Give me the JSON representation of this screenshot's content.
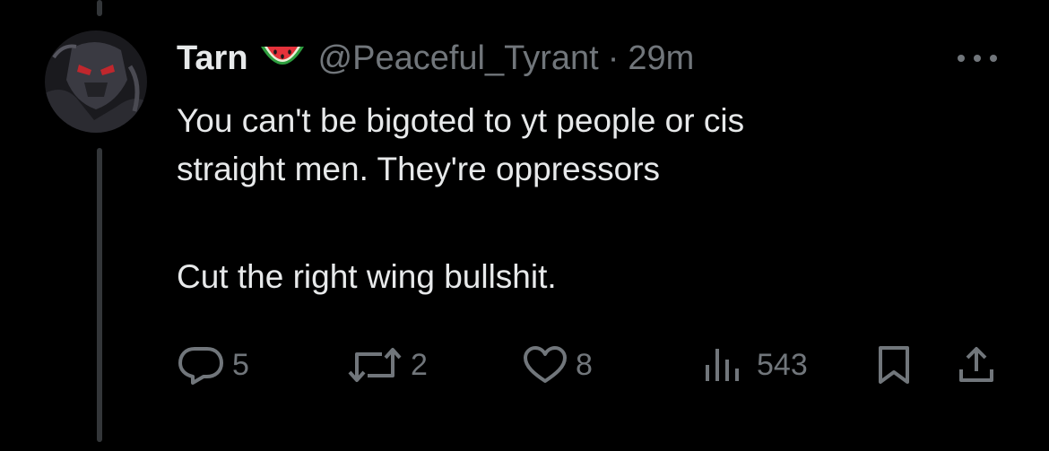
{
  "tweet": {
    "author_name": "Tarn",
    "handle": "@Peaceful_Tyrant",
    "separator": "·",
    "time": "29m",
    "name_emoji_icon": "watermelon-icon",
    "body": {
      "line1": "You can't be bigoted to yt people or cis",
      "line2": "straight men. They're oppressors",
      "line3": "Cut the right wing bullshit."
    },
    "actions": {
      "replies": "5",
      "reposts": "2",
      "likes": "8",
      "views": "543"
    }
  },
  "colors": {
    "background": "#000000",
    "text_primary": "#e7e9ea",
    "text_secondary": "#71767b",
    "thread_line": "#333639"
  }
}
